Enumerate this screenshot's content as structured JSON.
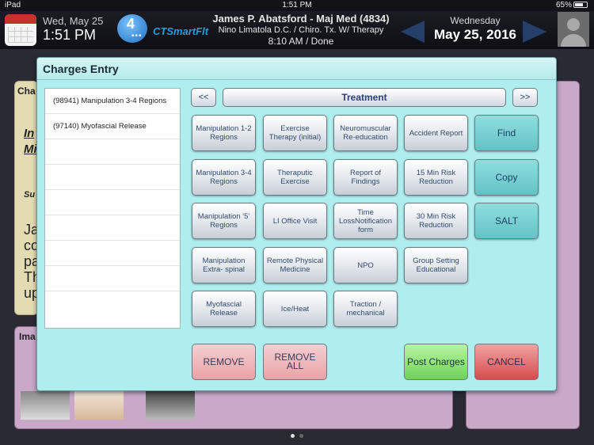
{
  "status_bar": {
    "device": "iPad",
    "time": "1:51 PM",
    "battery": "65%"
  },
  "header": {
    "date": "Wed, May 25",
    "time": "1:51 PM",
    "message_count": "4",
    "brand": "CTSmartFlt",
    "patient": {
      "name": "James P. Abatsford - Maj Med (4834)",
      "subtitle": "Nino Limatola D.C. / Chiro. Tx. W/ Therapy",
      "appointment": "8:10 AM / Done"
    },
    "day_name": "Wednesday",
    "day_date": "May 25, 2016"
  },
  "background": {
    "left_heading": "Cha",
    "left_italic_1": "In",
    "left_italic_2": "Mi",
    "left_small": "Su",
    "left_text": [
      "Ja",
      "co",
      "pa",
      "Th",
      "up"
    ],
    "images_heading": "Ima"
  },
  "dialog": {
    "title": "Charges Entry",
    "charges": [
      "(98941) Manipulation 3-4 Regions",
      "(97140) Myofascial Release",
      "",
      "",
      "",
      "",
      "",
      "",
      ""
    ],
    "nav_prev": "<<",
    "nav_next": ">>",
    "category": "Treatment",
    "treatments": [
      "Manipulation 1-2 Regions",
      "Exercise Therapy (initial)",
      "Neuromuscular Re-education",
      "Accident Report",
      "Manipulation 3-4 Regions",
      "Theraputic Exercise",
      "Report of Findings",
      "15 Min Risk Reduction",
      "Manipulation '5' Regions",
      "LI Office Visit",
      "Time LossNotification form",
      "30 Min Risk Reduction",
      "Manipulation Extra- spinal",
      "Remote Physical Medicine",
      "NPO",
      "Group Setting Educational",
      "Myofascial Release",
      "Ice/Heat",
      "Traction / mechanical"
    ],
    "side_buttons": {
      "find": "Find",
      "copy": "Copy",
      "salt": "SALT"
    },
    "actions": {
      "remove": "REMOVE",
      "remove_all": "REMOVE ALL",
      "post": "Post Charges",
      "cancel": "CANCEL"
    }
  }
}
